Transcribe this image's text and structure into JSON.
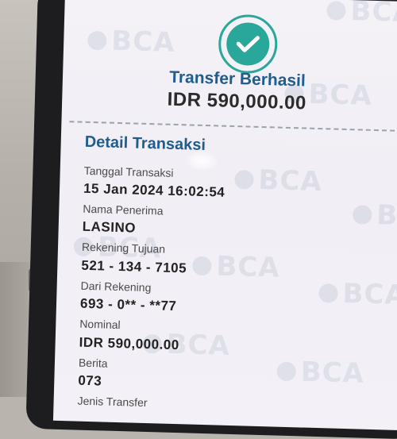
{
  "header": {
    "icon": "check-icon",
    "title": "Transfer Berhasil",
    "amount": "IDR 590,000.00"
  },
  "details": {
    "section_title": "Detail Transaksi",
    "fields": [
      {
        "label": "Tanggal Transaksi",
        "value": "15 Jan 2024 16:02:54"
      },
      {
        "label": "Nama Penerima",
        "value": "LASINO"
      },
      {
        "label": "Rekening Tujuan",
        "value": "521 - 134 - 7105"
      },
      {
        "label": "Dari Rekening",
        "value": "693 - 0** - **77"
      },
      {
        "label": "Nominal",
        "value": "IDR 590,000.00"
      },
      {
        "label": "Berita",
        "value": "073"
      },
      {
        "label": "Jenis Transfer",
        "value": ""
      }
    ]
  },
  "watermark": "BCA",
  "colors": {
    "accent_teal": "#2aa79b",
    "title_blue": "#1f5d8c"
  }
}
